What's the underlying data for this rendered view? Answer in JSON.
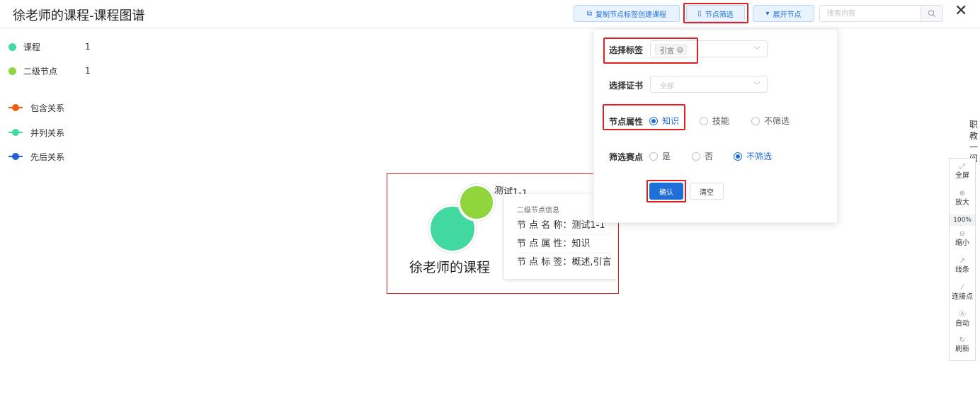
{
  "header": {
    "title": "徐老师的课程-课程图谱",
    "buttons": {
      "copy_tags": "复制节点标签创建课程",
      "node_filter": "节点筛选",
      "expand_nodes": "展开节点"
    },
    "search_placeholder": "搜索内容"
  },
  "legend": {
    "node_types": [
      {
        "label": "课程",
        "count": "1",
        "color": "#41d9a0"
      },
      {
        "label": "二级节点",
        "count": "1",
        "color": "#8fd63c"
      }
    ],
    "relations": [
      {
        "label": "包含关系",
        "color": "#e85d10"
      },
      {
        "label": "并列关系",
        "color": "#41d9a0"
      },
      {
        "label": "先后关系",
        "color": "#1f5fd8"
      }
    ]
  },
  "graph": {
    "main_node_label": "徐老师的课程",
    "sub_node_label": "测试1-1",
    "tooltip": {
      "title": "二级节点信息",
      "name_row": "节 点 名 称：测试1-1",
      "attr_row": "节 点 属 性：知识",
      "tags_row": "节 点 标 签：概述,引言"
    }
  },
  "filter": {
    "tag_label": "选择标签",
    "tag_value": "引言",
    "cert_label": "选择证书",
    "cert_value": "全部",
    "attr_label": "节点属性",
    "attr_options": [
      "知识",
      "技能",
      "不筛选"
    ],
    "attr_selected": "知识",
    "match_label": "筛选赛点",
    "match_options": [
      "是",
      "否",
      "不筛选"
    ],
    "match_selected": "不筛选",
    "confirm": "确认",
    "clear": "清空"
  },
  "side_text": "职教一问",
  "toolbar": {
    "fullscreen": "全屏",
    "zoom_in": "放大",
    "zoom_level": "100%",
    "zoom_out": "缩小",
    "lines": "线条",
    "connect": "连接点",
    "auto": "自动",
    "refresh": "刷新"
  }
}
